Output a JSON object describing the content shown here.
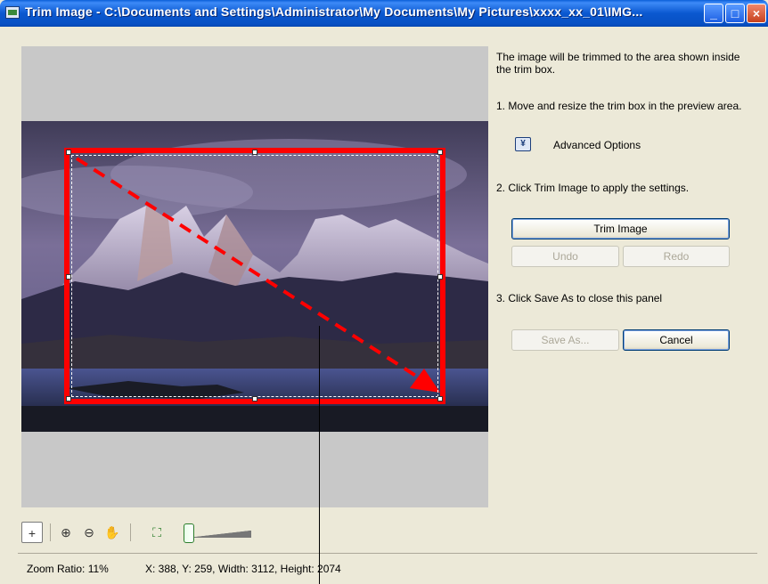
{
  "window": {
    "title": "Trim Image - C:\\Documents and Settings\\Administrator\\My Documents\\My Pictures\\xxxx_xx_01\\IMG...",
    "minimize_glyph": "_",
    "maximize_glyph": "□",
    "close_glyph": "×"
  },
  "panel": {
    "intro": "The image will be trimmed to the area shown inside the trim box.",
    "step1": "1.  Move and resize the trim box in the preview area.",
    "advanced_options": "Advanced Options",
    "step2": "2. Click Trim Image to apply the settings.",
    "trim_button": "Trim Image",
    "undo_button": "Undo",
    "redo_button": "Redo",
    "step3": "3. Click Save As to close this panel",
    "save_as_button": "Save As...",
    "cancel_button": "Cancel"
  },
  "toolbar": {
    "icons": [
      "trim-tool-icon",
      "zoom-in-icon",
      "zoom-out-icon",
      "hand-pan-icon",
      "fit-to-window-icon",
      "zoom-slider"
    ],
    "trim_glyph": "+",
    "zoom_in_glyph": "⊕",
    "zoom_out_glyph": "⊖",
    "hand_glyph": "✋",
    "fit_glyph": "⛶"
  },
  "status": {
    "zoom_ratio": "Zoom Ratio: 11%",
    "selection": "X: 388, Y: 259, Width: 3112, Height: 2074"
  },
  "colors": {
    "trim_box": "#ff0000",
    "titlebar": "#0a58d0",
    "window_bg": "#ece9d8"
  }
}
